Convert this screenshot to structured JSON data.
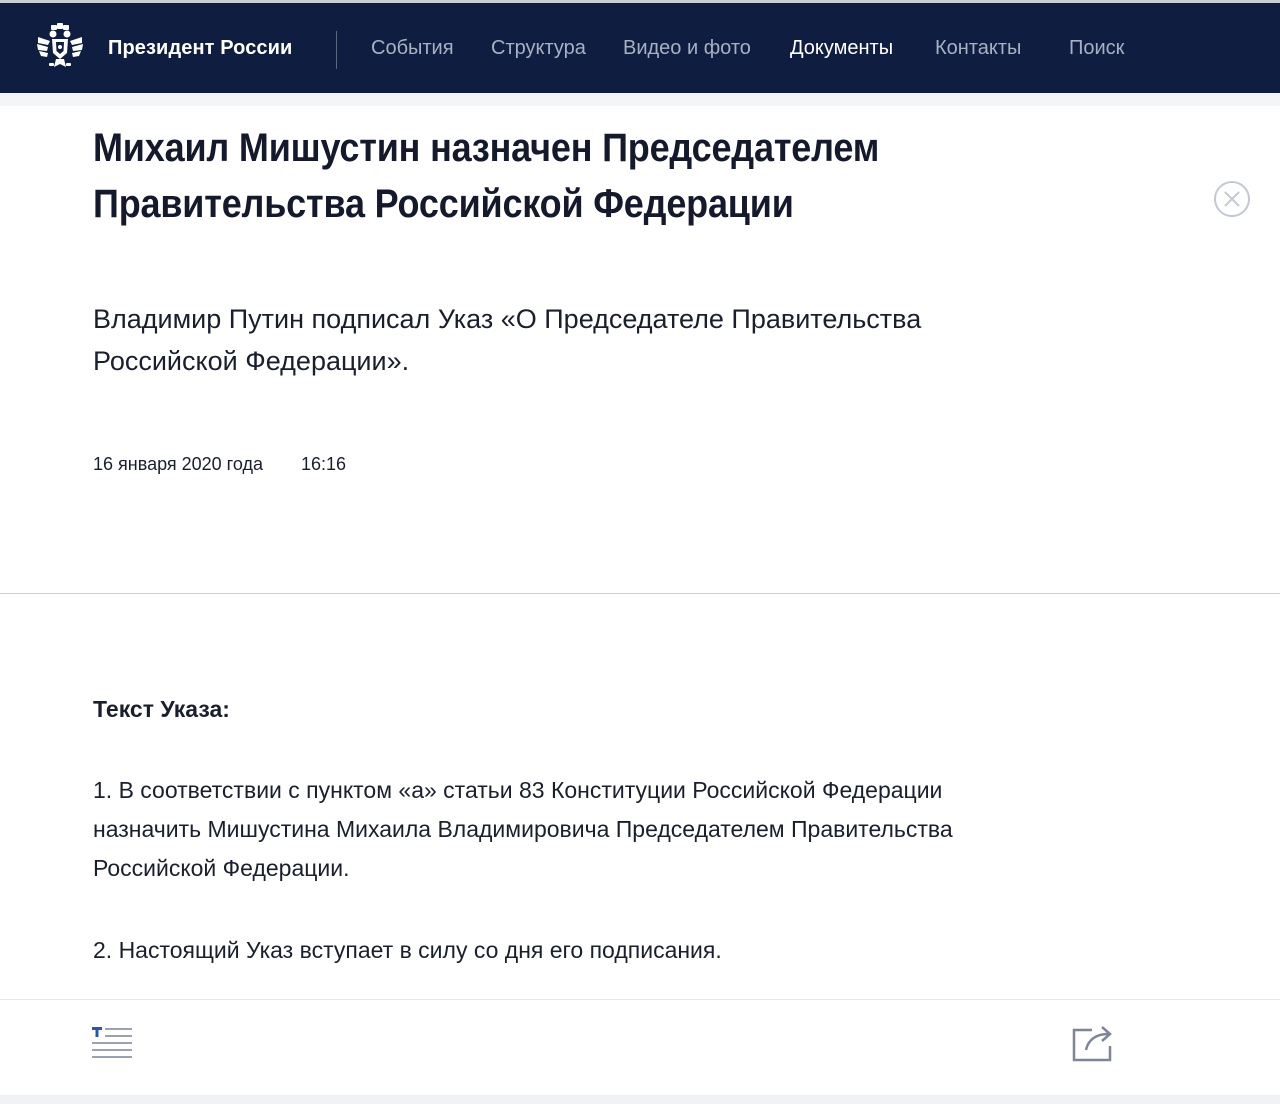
{
  "header": {
    "brand": "Президент России",
    "nav": [
      {
        "label": "События",
        "active": false
      },
      {
        "label": "Структура",
        "active": false
      },
      {
        "label": "Видео и фото",
        "active": false
      },
      {
        "label": "Документы",
        "active": true
      },
      {
        "label": "Контакты",
        "active": false
      },
      {
        "label": "Поиск",
        "active": false
      }
    ]
  },
  "article": {
    "title_line1": "Михаил Мишустин назначен Председателем",
    "title_line2": "Правительства Российской Федерации",
    "lead": "Владимир Путин подписал Указ «О Председателе Правительства Российской Федерации».",
    "date": "16 января 2020 года",
    "time": "16:16",
    "doc_heading": "Текст Указа:",
    "paragraph1": "1. В соответствии с пунктом «а» статьи 83 Конституции Российской Федерации назначить Мишустина Михаила Владимировича Председателем Правительства Российской Федерации.",
    "paragraph2": "2. Настоящий Указ вступает в силу со дня его подписания."
  },
  "icons": {
    "logo": "double-headed-eagle-icon",
    "close": "close-icon",
    "text_mode": "text-mode-icon",
    "share": "share-icon"
  },
  "colors": {
    "navbar_bg": "#0f1d40",
    "nav_text": "#a9b0c2",
    "nav_active": "#ffffff",
    "separator": "#a6dfe0",
    "accent_blue": "#2e56a8"
  }
}
